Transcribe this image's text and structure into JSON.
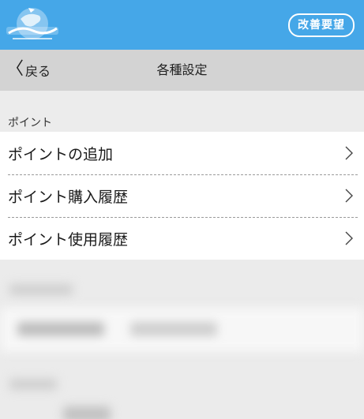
{
  "header": {
    "logo_icon": "happy-mail-logo",
    "feedback_label": "改善要望",
    "bar_color": "#45a7e8"
  },
  "nav": {
    "back_label": "戻る",
    "back_icon": "chevron-left-icon",
    "title": "各種設定"
  },
  "points_section": {
    "header": "ポイント",
    "items": [
      {
        "label": "ポイントの追加",
        "icon": "chevron-right-icon"
      },
      {
        "label": "ポイント購入履歴",
        "icon": "chevron-right-icon"
      },
      {
        "label": "ポイント使用履歴",
        "icon": "chevron-right-icon"
      }
    ]
  }
}
